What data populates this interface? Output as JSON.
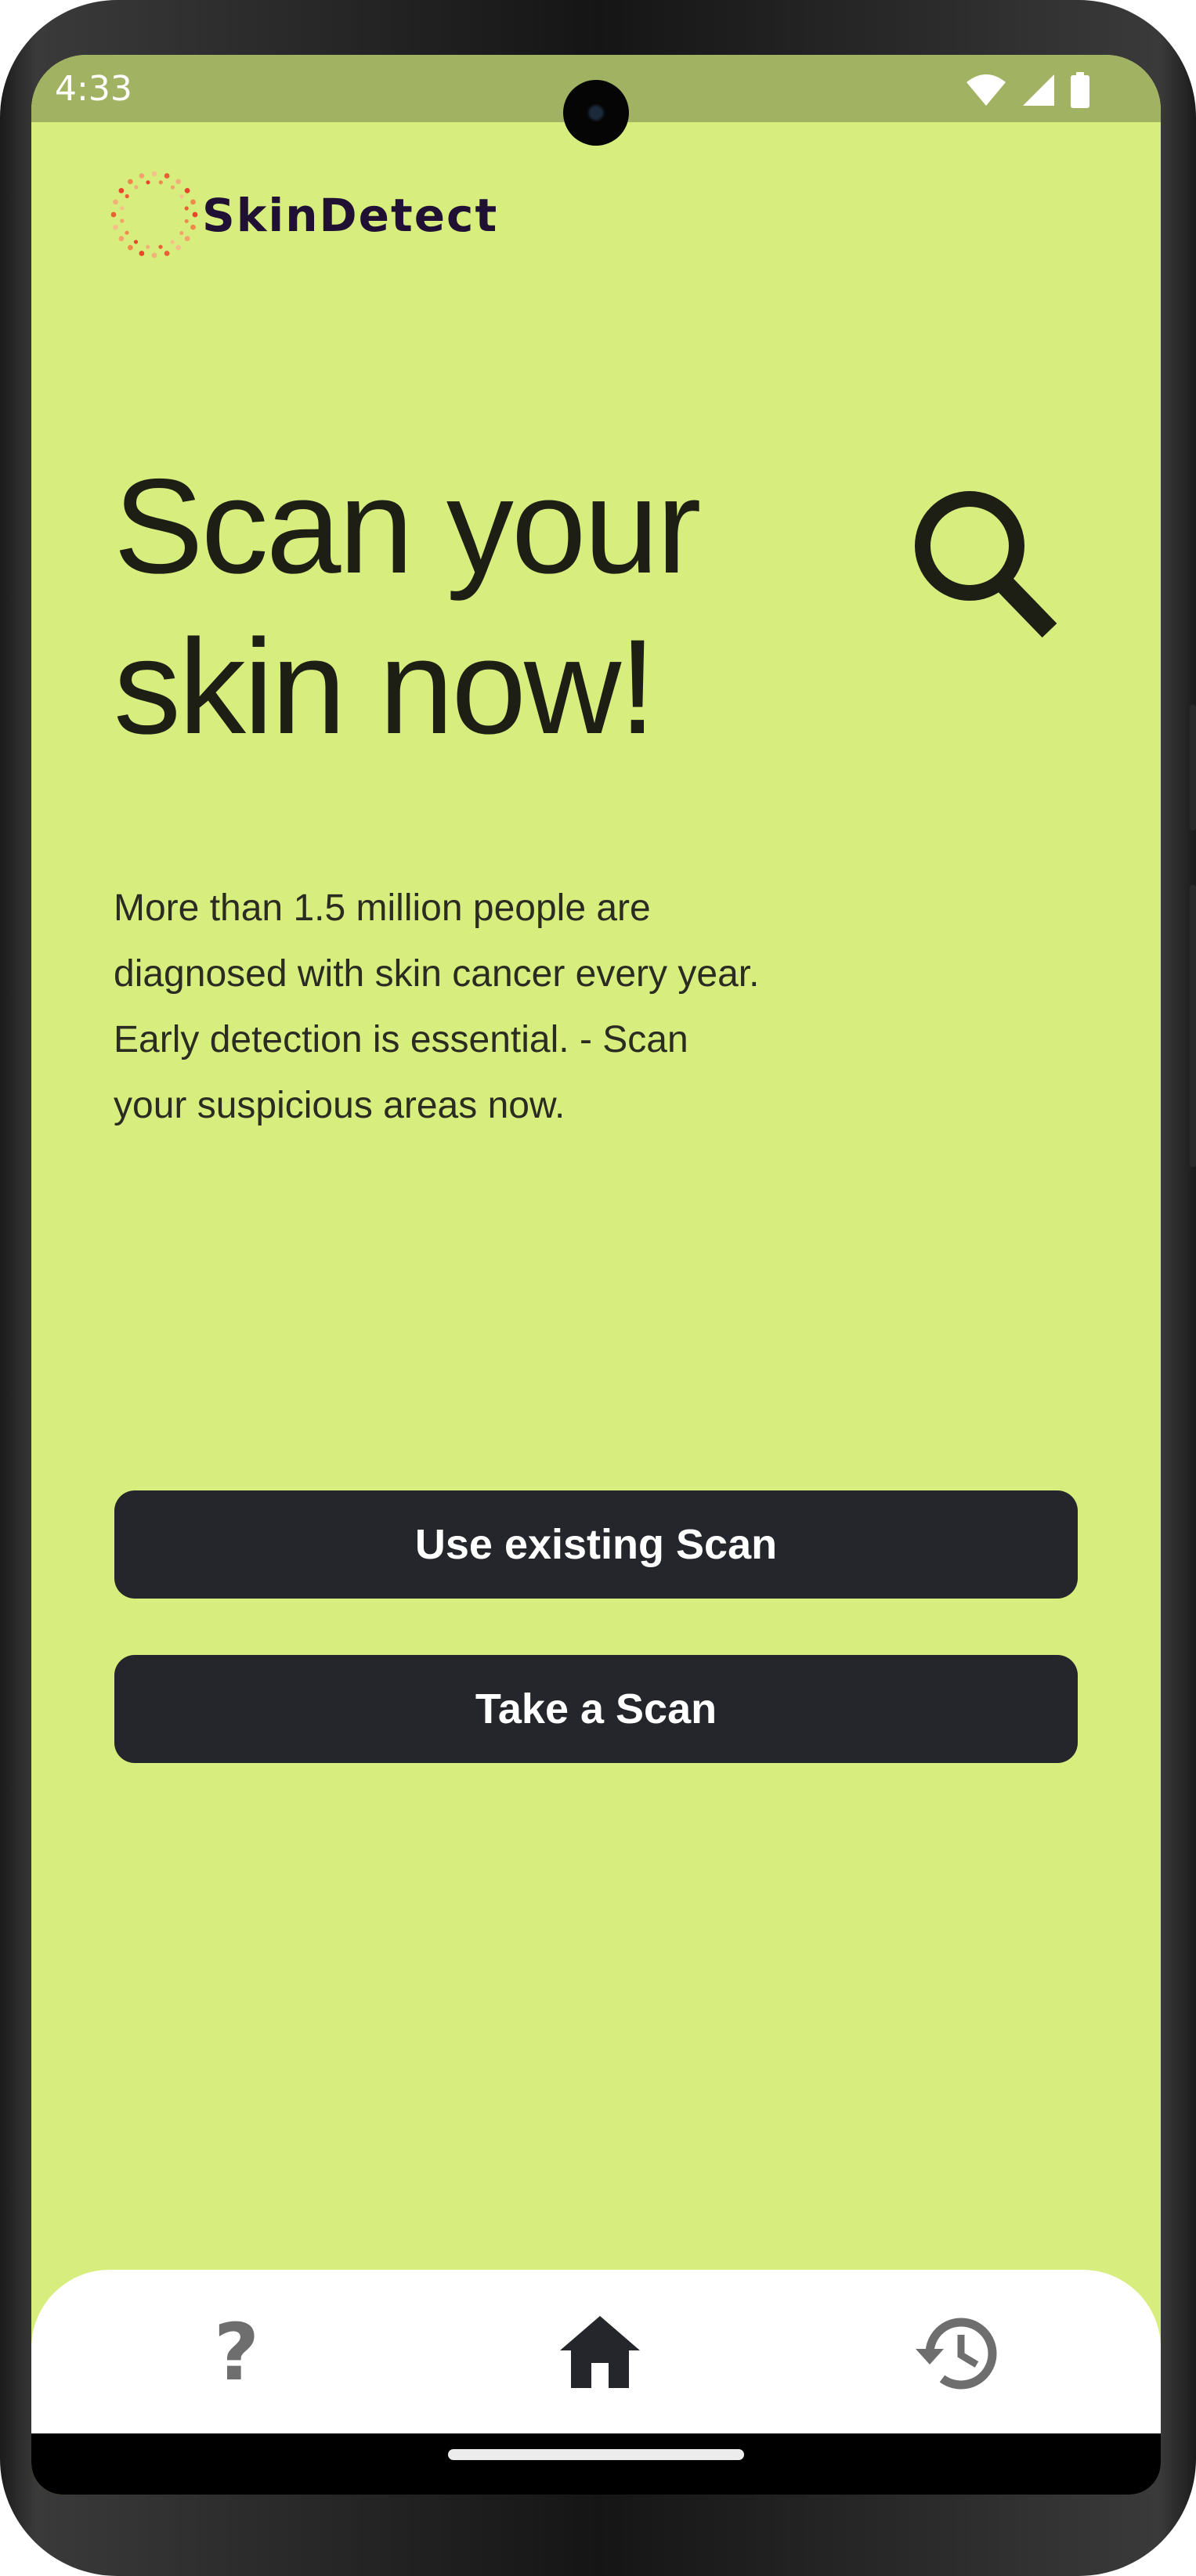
{
  "status_bar": {
    "time": "4:33",
    "icons": [
      "wifi-icon",
      "cellular-signal-icon",
      "battery-icon"
    ]
  },
  "app": {
    "name": "SkinDetect",
    "logo_icon": "sunburst-dots-logo"
  },
  "hero": {
    "headline_line1": "Scan your",
    "headline_line2": "skin now!",
    "icon": "search-icon",
    "intro": "More than 1.5 million people are diagnosed with skin cancer every year. Early detection is essential. - Scan your suspicious areas now."
  },
  "actions": {
    "use_existing_label": "Use existing Scan",
    "take_scan_label": "Take a Scan"
  },
  "bottom_nav": {
    "items": [
      {
        "id": "help",
        "icon": "help-icon",
        "selected": false
      },
      {
        "id": "home",
        "icon": "home-icon",
        "selected": true
      },
      {
        "id": "history",
        "icon": "history-icon",
        "selected": false
      }
    ]
  },
  "colors": {
    "background": "#d7ee7e",
    "status_bar": "#a1b363",
    "button": "#24262b",
    "button_text": "#ffffff",
    "text": "#1d1f14",
    "logo_text": "#201034",
    "nav_background": "#ffffff",
    "nav_active": "#24262b",
    "nav_inactive": "#6e6e6e"
  }
}
